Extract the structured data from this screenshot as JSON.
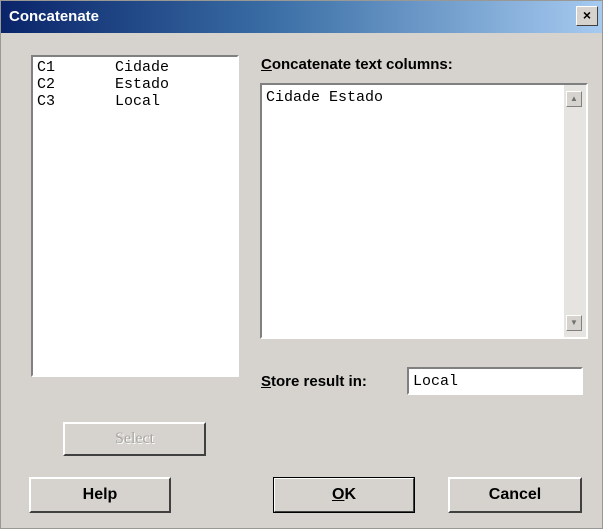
{
  "window": {
    "title": "Concatenate",
    "close_glyph": "×"
  },
  "column_list": {
    "rows": [
      {
        "id": "C1",
        "name": "Cidade"
      },
      {
        "id": "C2",
        "name": "Estado"
      },
      {
        "id": "C3",
        "name": "Local"
      }
    ]
  },
  "concatenate": {
    "label_accel": "C",
    "label_rest": "oncatenate text columns:",
    "value": "Cidade Estado",
    "scroll_up_glyph": "▲",
    "scroll_down_glyph": "▼"
  },
  "store": {
    "label_accel": "S",
    "label_rest": "tore result in:",
    "value": "Local"
  },
  "buttons": {
    "select": "Select",
    "help": "Help",
    "ok_accel": "O",
    "ok_rest": "K",
    "cancel": "Cancel"
  }
}
